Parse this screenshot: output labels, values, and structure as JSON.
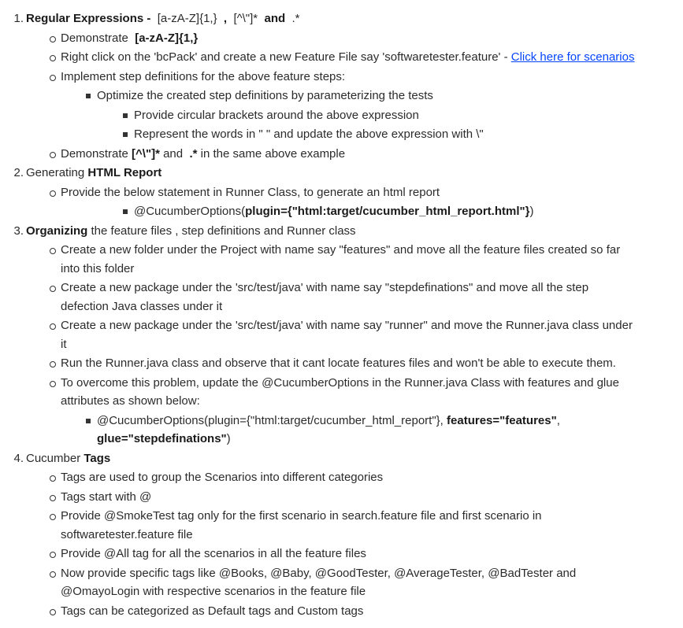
{
  "items": [
    {
      "level": 1,
      "marker": "1.",
      "lines": [
        [
          {
            "t": "Regular Expressions - ",
            "b": true
          },
          {
            "t": " [a-zA-Z]{1,} "
          },
          {
            "t": " ,  ",
            "b": true
          },
          {
            "t": "[^\\\"]* "
          },
          {
            "t": " and ",
            "b": true
          },
          {
            "t": " .*"
          }
        ]
      ]
    },
    {
      "level": 2,
      "marker": "circle",
      "lines": [
        [
          {
            "t": "Demonstrate  "
          },
          {
            "t": "[a-zA-Z]{1,}",
            "b": true
          }
        ]
      ]
    },
    {
      "level": 2,
      "marker": "circle",
      "lines": [
        [
          {
            "t": "Right click on the 'bcPack' and create a new Feature File say 'softwaretester.feature' - "
          },
          {
            "t": "Click here for scenarios",
            "link": true
          }
        ]
      ]
    },
    {
      "level": 2,
      "marker": "circle",
      "lines": [
        [
          {
            "t": "Implement step definitions for the above feature steps:"
          }
        ]
      ]
    },
    {
      "level": 3,
      "marker": "square",
      "lines": [
        [
          {
            "t": "Optimize the created step definitions by parameterizing the tests"
          }
        ]
      ]
    },
    {
      "level": 4,
      "marker": "square",
      "lines": [
        [
          {
            "t": "Provide circular brackets around the above expression"
          }
        ]
      ]
    },
    {
      "level": 4,
      "marker": "square",
      "lines": [
        [
          {
            "t": "Represent the words in \" \" and update the above expression with \\\""
          }
        ]
      ]
    },
    {
      "level": 2,
      "marker": "circle",
      "lines": [
        [
          {
            "t": "Demonstrate "
          },
          {
            "t": "[^\\\"]*",
            "b": true
          },
          {
            "t": " and  "
          },
          {
            "t": ".*",
            "b": true
          },
          {
            "t": " in the same above example"
          }
        ]
      ]
    },
    {
      "level": 1,
      "marker": "2.",
      "lines": [
        [
          {
            "t": "Generating "
          },
          {
            "t": "HTML Report",
            "b": true
          }
        ]
      ]
    },
    {
      "level": 2,
      "marker": "circle",
      "lines": [
        [
          {
            "t": "Provide the below statement in Runner Class, to generate an html report"
          }
        ]
      ]
    },
    {
      "level": 4,
      "marker": "square",
      "lines": [
        [
          {
            "t": "@CucumberOptions("
          },
          {
            "t": "plugin={\"html:target/cucumber_html_report.html\"}",
            "b": true
          },
          {
            "t": ")"
          }
        ]
      ]
    },
    {
      "level": 1,
      "marker": "3.",
      "lines": [
        [
          {
            "t": "Organizing",
            "b": true
          },
          {
            "t": " the feature files , step definitions and Runner class"
          }
        ]
      ]
    },
    {
      "level": 2,
      "marker": "circle",
      "lines": [
        [
          {
            "t": "Create a new folder under the Project with name say \"features\" and move all the feature files created so far"
          }
        ],
        [
          {
            "t": "into this folder"
          }
        ]
      ]
    },
    {
      "level": 2,
      "marker": "circle",
      "lines": [
        [
          {
            "t": "Create a new package under the 'src/test/java' with name say \"stepdefinations\" and move all the step"
          }
        ],
        [
          {
            "t": "defection Java classes under it"
          }
        ]
      ]
    },
    {
      "level": 2,
      "marker": "circle",
      "lines": [
        [
          {
            "t": "Create a new package under the 'src/test/java' with name say \"runner\" and move the Runner.java class under"
          }
        ],
        [
          {
            "t": "it"
          }
        ]
      ]
    },
    {
      "level": 2,
      "marker": "circle",
      "lines": [
        [
          {
            "t": "Run the Runner.java class and observe that it cant locate features files and won't be able to execute them."
          }
        ]
      ]
    },
    {
      "level": 2,
      "marker": "circle",
      "lines": [
        [
          {
            "t": "To overcome this problem, update the @CucumberOptions in the Runner.java Class with features and glue"
          }
        ],
        [
          {
            "t": "attributes as shown below:"
          }
        ]
      ]
    },
    {
      "level": 3,
      "marker": "square",
      "lines": [
        [
          {
            "t": "@CucumberOptions(plugin={\"html:target/cucumber_html_report\"}, "
          },
          {
            "t": "features=\"features\"",
            "b": true
          },
          {
            "t": ","
          }
        ],
        [
          {
            "t": "glue=\"stepdefinations\"",
            "b": true
          },
          {
            "t": ")"
          }
        ]
      ]
    },
    {
      "level": 1,
      "marker": "4.",
      "lines": [
        [
          {
            "t": "Cucumber "
          },
          {
            "t": "Tags",
            "b": true
          }
        ]
      ]
    },
    {
      "level": 2,
      "marker": "circle",
      "lines": [
        [
          {
            "t": "Tags are used to group the Scenarios into different categories"
          }
        ]
      ]
    },
    {
      "level": 2,
      "marker": "circle",
      "lines": [
        [
          {
            "t": "Tags start with @"
          }
        ]
      ]
    },
    {
      "level": 2,
      "marker": "circle",
      "lines": [
        [
          {
            "t": "Provide @SmokeTest tag only for the first scenario in search.feature file and first scenario in"
          }
        ],
        [
          {
            "t": "softwaretester.feature file"
          }
        ]
      ]
    },
    {
      "level": 2,
      "marker": "circle",
      "lines": [
        [
          {
            "t": "Provide @All tag for all the scenarios in all the feature files"
          }
        ]
      ]
    },
    {
      "level": 2,
      "marker": "circle",
      "lines": [
        [
          {
            "t": "Now provide specific tags like @Books, @Baby, @GoodTester, @AverageTester, @BadTester and"
          }
        ],
        [
          {
            "t": "@OmayoLogin with respective scenarios in the feature file"
          }
        ]
      ]
    },
    {
      "level": 2,
      "marker": "circle",
      "lines": [
        [
          {
            "t": "Tags can be categorized as Default tags and Custom tags"
          }
        ]
      ]
    }
  ]
}
